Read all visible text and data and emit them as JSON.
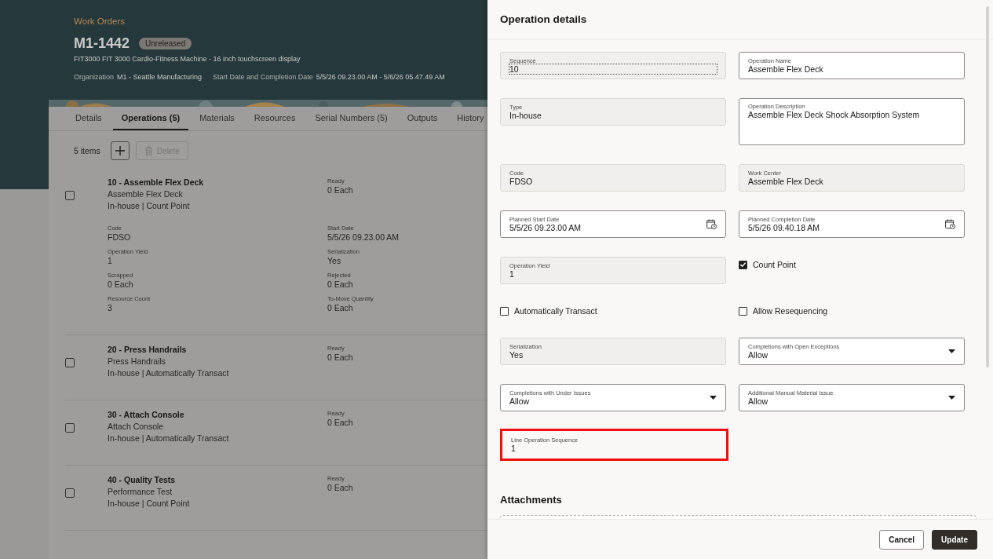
{
  "header": {
    "breadcrumb": "Work Orders",
    "title": "M1-1442",
    "status": "Unreleased",
    "description": "FIT3000 FIT 3000 Cardio-Fitness Machine - 16 inch touchscreen display",
    "meta": [
      {
        "label": "Organization",
        "value": "M1 - Seattle Manufacturing"
      },
      {
        "label": "Start Date and Completion Date",
        "value": "5/5/26 09.23.00 AM - 5/6/26 05.47.49 AM"
      }
    ]
  },
  "tabs": [
    {
      "label": "Details",
      "selected": false
    },
    {
      "label": "Operations (5)",
      "selected": true
    },
    {
      "label": "Materials",
      "selected": false
    },
    {
      "label": "Resources",
      "selected": false
    },
    {
      "label": "Serial Numbers (5)",
      "selected": false
    },
    {
      "label": "Outputs",
      "selected": false
    },
    {
      "label": "History",
      "selected": false
    }
  ],
  "toolbar": {
    "count": "5 items",
    "delete_label": "Delete",
    "delete_disabled": true
  },
  "operations": [
    {
      "title": "10 - Assemble Flex Deck",
      "description": "Assemble Flex Deck",
      "attributes": "In-house | Count Point",
      "checked": false,
      "ready_label": "Ready",
      "ready": "0 Each",
      "details": [
        {
          "label": "Code",
          "value": "FDSO"
        },
        {
          "label": "Start Date",
          "value": "5/5/26 09.23.00 AM"
        },
        {
          "label": "Operation Yield",
          "value": "1"
        },
        {
          "label": "Serialization",
          "value": "Yes"
        },
        {
          "label": "Scrapped",
          "value": "0 Each"
        },
        {
          "label": "Rejected",
          "value": "0 Each"
        },
        {
          "label": "Resource Count",
          "value": "3"
        },
        {
          "label": "To-Move Quantity",
          "value": "0 Each"
        }
      ]
    },
    {
      "title": "20 - Press Handrails",
      "description": "Press Handrails",
      "attributes": "In-house | Automatically Transact",
      "checked": false,
      "ready_label": "Ready",
      "ready": "0 Each"
    },
    {
      "title": "30 - Attach Console",
      "description": "Attach Console",
      "attributes": "In-house | Automatically Transact",
      "checked": false,
      "ready_label": "Ready",
      "ready": "0 Each"
    },
    {
      "title": "40 - Quality Tests",
      "description": "Performance Test",
      "attributes": "In-house | Count Point",
      "checked": false,
      "ready_label": "Ready",
      "ready": "0 Each"
    }
  ],
  "panel": {
    "title": "Operation details",
    "fields": [
      {
        "kind": "readonly",
        "label": "Sequence",
        "value": "10",
        "focused": true
      },
      {
        "kind": "text",
        "label": "Operation Name",
        "value": "Assemble Flex Deck"
      },
      {
        "kind": "readonly",
        "label": "Type",
        "value": "In-house"
      },
      {
        "kind": "textarea",
        "label": "Operation Description",
        "value": "Assemble Flex Deck Shock Absorption System"
      },
      {
        "kind": "readonly",
        "label": "Code",
        "value": "FDSO"
      },
      {
        "kind": "readonly",
        "label": "Work Center",
        "value": "Assemble Flex Deck"
      },
      {
        "kind": "date",
        "label": "Planned Start Date",
        "value": "5/5/26 09.23.00 AM"
      },
      {
        "kind": "date",
        "label": "Planned Completion Date",
        "value": "5/5/26 09.40.18 AM"
      },
      {
        "kind": "readonly",
        "label": "Operation Yield",
        "value": "1"
      },
      {
        "kind": "checkbox",
        "label": "Count Point",
        "checked": true
      },
      {
        "kind": "checkbox",
        "label": "Automatically Transact",
        "checked": false
      },
      {
        "kind": "checkbox",
        "label": "Allow Resequencing",
        "checked": false
      },
      {
        "kind": "readonly",
        "label": "Serialization",
        "value": "Yes"
      },
      {
        "kind": "select",
        "label": "Completions with Open Exceptions",
        "value": "Allow"
      },
      {
        "kind": "select",
        "label": "Completions with Under Issues",
        "value": "Allow"
      },
      {
        "kind": "select",
        "label": "Additional Manual Material Issue",
        "value": "Allow"
      },
      {
        "kind": "readonly",
        "label": "Line Operation Sequence",
        "value": "1",
        "highlighted": true
      }
    ],
    "attachments_title": "Attachments",
    "buttons": [
      {
        "label": "Cancel",
        "kind": "secondary"
      },
      {
        "label": "Update",
        "kind": "primary"
      }
    ]
  }
}
